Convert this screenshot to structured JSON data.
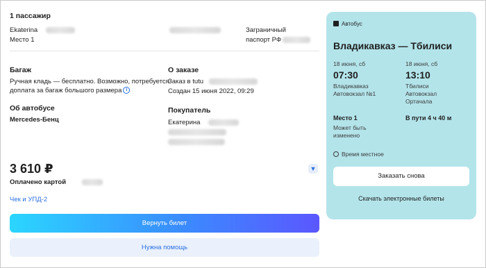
{
  "passenger": {
    "header": "1 пассажир",
    "name": "Ekaterina",
    "seat": "Место 1",
    "doc_type_line1": "Заграничный",
    "doc_type_line2": "паспорт РФ"
  },
  "baggage": {
    "header": "Багаж",
    "line1": "Ручная кладь — бесплатно. Возможно, потребуется",
    "line2": "доплата за багаж большого размера"
  },
  "order": {
    "header": "О заказе",
    "order_line": "Заказ в tutu",
    "created": "Создан 15 июня 2022, 09:29"
  },
  "bus": {
    "header": "Об автобусе",
    "model": "Mercedes-Бенц"
  },
  "buyer": {
    "header": "Покупатель",
    "name": "Екатерина"
  },
  "payment": {
    "price": "3 610 ₽",
    "paid_by": "Оплачено картой",
    "receipt_link": "Чек и УПД-2"
  },
  "actions": {
    "return_ticket": "Вернуть билет",
    "need_help": "Нужна помощь"
  },
  "trip_card": {
    "badge": "Автобус",
    "route": "Владикавказ — Тбилиси",
    "departure": {
      "date": "18 июня, сб",
      "time": "07:30",
      "city": "Владикавказ",
      "station": "Автовокзал №1"
    },
    "arrival": {
      "date": "18 июня, сб",
      "time": "13:10",
      "city": "Тбилиси",
      "station": "Автовокзал",
      "station2": "Ортачала"
    },
    "seat": "Место 1",
    "seat_note_line1": "Может быть",
    "seat_note_line2": "изменено",
    "duration": "В пути 4 ч 40 м",
    "local_time": "Время местное",
    "order_again": "Заказать снова",
    "download_tickets": "Скачать электронные билеты",
    "color_card": "#b3e4ea",
    "color_accent": "#2b6fe0"
  }
}
